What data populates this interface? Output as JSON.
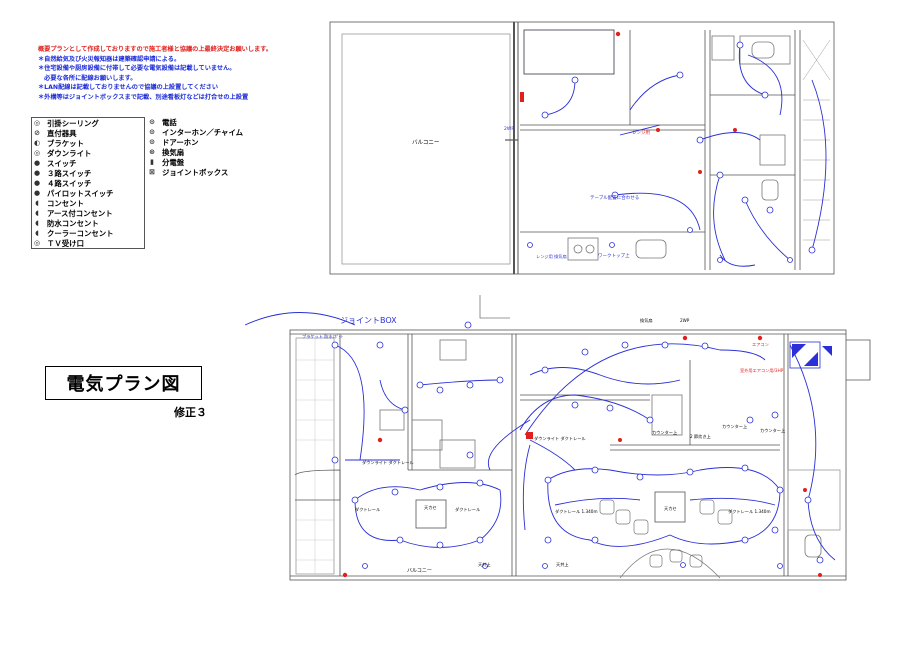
{
  "notes": [
    "概要プランとして作成しておりますので施工者様と協議の上最終決定お願いします。",
    "＊自然給気及び火災報知器は建築確認申請による。",
    "＊住宅設備や厨房設備に付帯して必要な電気設備は記載していません。",
    "　必要な各所に配線お願いします。",
    "＊LAN配線は記載しておりませんので協議の上設置してください",
    "＊外構等はジョイントボックスまで記載、別途看板灯などは打合せの上設置"
  ],
  "legend_left": [
    {
      "icon": "pendant-ceiling-icon",
      "label": "引掛シーリング"
    },
    {
      "icon": "direct-fixture-icon",
      "label": "直付器具"
    },
    {
      "icon": "bracket-icon",
      "label": "ブラケット"
    },
    {
      "icon": "downlight-icon",
      "label": "ダウンライト"
    },
    {
      "icon": "switch-icon",
      "label": "スイッチ"
    },
    {
      "icon": "three-way-switch-icon",
      "label": "３路スイッチ"
    },
    {
      "icon": "four-way-switch-icon",
      "label": "４路スイッチ"
    },
    {
      "icon": "pilot-switch-icon",
      "label": "パイロットスイッチ"
    },
    {
      "icon": "outlet-icon",
      "label": "コンセント"
    },
    {
      "icon": "earth-outlet-icon",
      "label": "アース付コンセント"
    },
    {
      "icon": "waterproof-outlet-icon",
      "label": "防水コンセント"
    },
    {
      "icon": "cooler-outlet-icon",
      "label": "クーラーコンセント"
    },
    {
      "icon": "tv-outlet-icon",
      "label": "ＴＶ受け口"
    }
  ],
  "legend_right": [
    {
      "icon": "telephone-icon",
      "label": "電話"
    },
    {
      "icon": "intercom-icon",
      "label": "インターホン／チャイム"
    },
    {
      "icon": "door-phone-icon",
      "label": "ドアーホン"
    },
    {
      "icon": "ventilation-fan-icon",
      "label": "換気扇"
    },
    {
      "icon": "distribution-board-icon",
      "label": "分電盤"
    },
    {
      "icon": "junction-box-icon",
      "label": "ジョイントボックス"
    }
  ],
  "title": "電気プラン図",
  "revision": "修正３",
  "labels": {
    "balcony": "バルコニー",
    "joint_box": "ジョイントBOX",
    "range_use": "レンジ用",
    "table_note": "テーブル配置に合わせる",
    "worktop": "ワークトップ上",
    "range_hood": "レンジ用 換気扇",
    "two_wp": "2WP",
    "ac_outdoor": "室外用エアコン用/3HP",
    "duct_rail_1": "ダクトレール",
    "duct_rail_2": "ダクトレール",
    "duct_rail_3": "ダクトレール 1.340m",
    "duct_rail_4": "ダクトレール 1.340m",
    "downlight_duct_1": "ダウンライト ダクトレール",
    "downlight_duct_2": "ダウンライト ダクトレール",
    "counter_1": "カウンター上",
    "counter_2": "カウンター上",
    "counter_3": "カウンター上",
    "grill": "2 節炊き上",
    "fan_left": "天カセ",
    "fan_right": "天カセ",
    "kitchen_hood": "換気扇",
    "cold_room": "冷蔵庫用",
    "ceiling_left": "天井上",
    "ceiling_right": "天井上",
    "bracket_left": "ブラケット 防水ｽﾎﾟｯﾄ",
    "ac_label": "エアコン"
  }
}
